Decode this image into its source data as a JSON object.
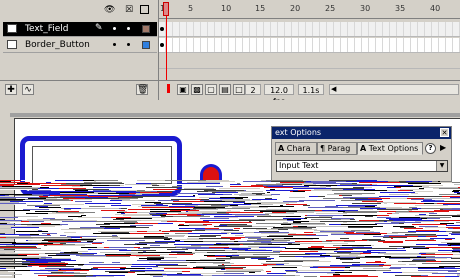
{
  "timeline": {
    "header_icons": {
      "eye": "eye-icon",
      "lock": "lock-icon",
      "outline": "outline-icon"
    },
    "layers": [
      {
        "name": "Text_Field",
        "selected": true,
        "color": "#a07868"
      },
      {
        "name": "Border_Button",
        "selected": false,
        "color": "#3080e0"
      }
    ],
    "ruler_ticks": [
      "1",
      "5",
      "10",
      "15",
      "20",
      "25",
      "30",
      "35",
      "40"
    ],
    "frame_rate": "12.0 fps",
    "current_frame": "2",
    "elapsed": "1.1s"
  },
  "text_options": {
    "title": "ext Options",
    "tabs": [
      "Chara",
      "Parag",
      "Text Options"
    ],
    "type_value": "Input Text"
  },
  "colors": {
    "stage_blue": "#1a1ad0",
    "red": "#dd1111",
    "title_bar": "#0a246a"
  }
}
